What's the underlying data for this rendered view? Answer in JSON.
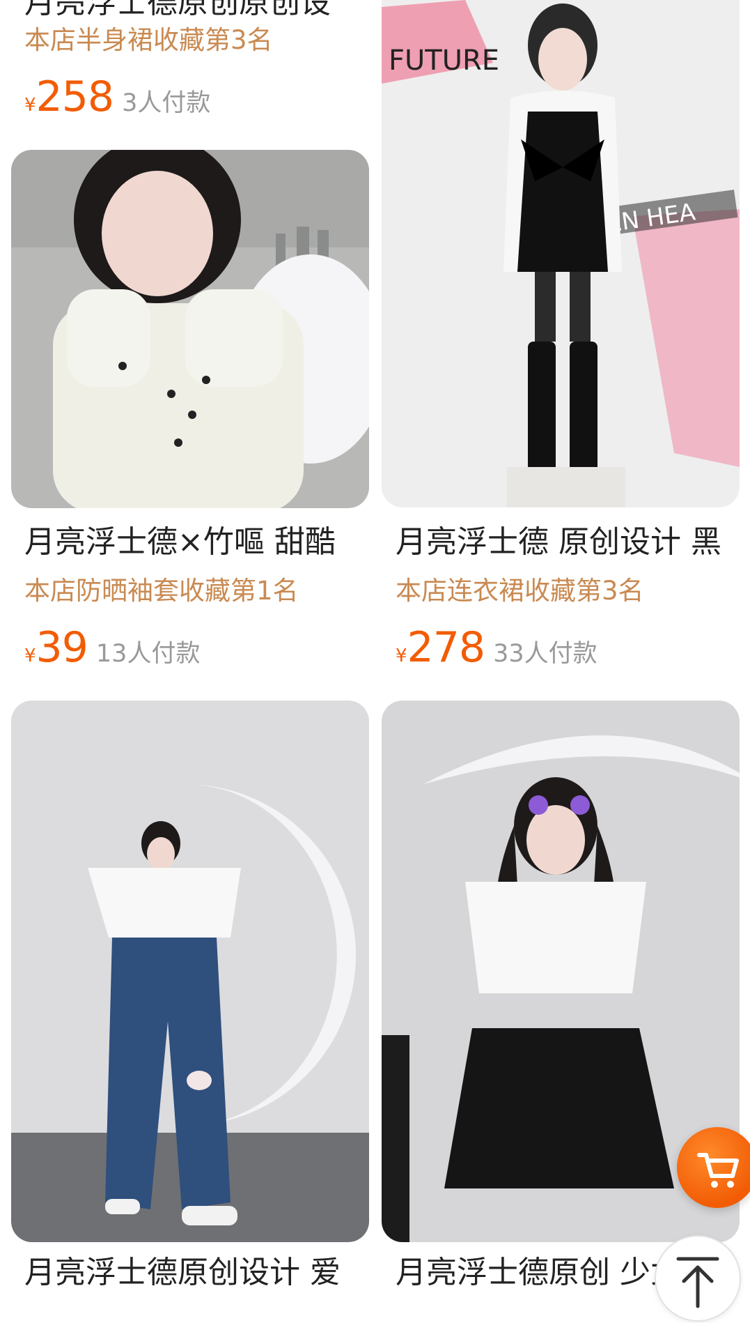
{
  "theme": {
    "price_color": "#f25c05",
    "rank_color": "#c98a52",
    "muted_color": "#999999",
    "cart_button_color": "#f25c05"
  },
  "products": [
    {
      "title": "月亮浮士德原创原创设",
      "rank": "本店半身裙收藏第3名",
      "currency": "¥",
      "price": "258",
      "paid": "3人付款"
    },
    {
      "title": "",
      "rank": "",
      "currency": "",
      "price": "",
      "paid": ""
    },
    {
      "title": "月亮浮士德×竹嘔 甜酷",
      "rank": "本店防晒袖套收藏第1名",
      "currency": "¥",
      "price": "39",
      "paid": "13人付款"
    },
    {
      "title": "月亮浮士德 原创设计 黑",
      "rank": "本店连衣裙收藏第3名",
      "currency": "¥",
      "price": "278",
      "paid": "33人付款"
    },
    {
      "title": "月亮浮士德原创设计 爱",
      "rank": "",
      "currency": "",
      "price": "",
      "paid": ""
    },
    {
      "title": "月亮浮士德原创 少女",
      "rank": "",
      "currency": "",
      "price": "",
      "paid": ""
    }
  ],
  "images": {
    "card2_text_future": "FUTURE",
    "card2_text_heart": "KEN HEA"
  },
  "floating": {
    "cart_icon": "shopping-cart-icon",
    "top_icon": "back-to-top-icon"
  }
}
